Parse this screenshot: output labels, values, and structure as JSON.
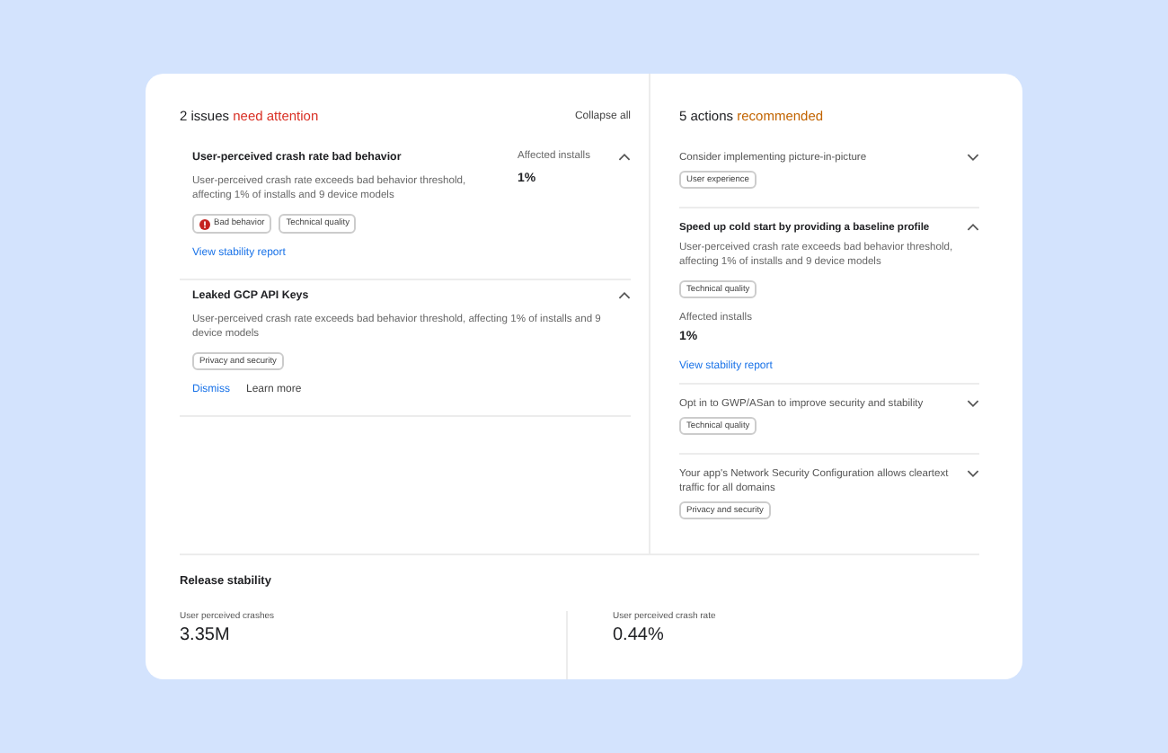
{
  "issues": {
    "count": "2 issues",
    "highlight": "need attention",
    "collapse_all": "Collapse all",
    "items": [
      {
        "title": "User-perceived crash rate bad behavior",
        "expanded": true,
        "description": "User-perceived crash rate exceeds bad behavior threshold, affecting 1% of installs and 9 device models",
        "metric_label": "Affected installs",
        "metric_value": "1%",
        "tags": [
          {
            "label": "Bad behavior",
            "kind": "error"
          },
          {
            "label": "Technical quality"
          }
        ],
        "links": [
          "View stability report"
        ]
      },
      {
        "title": "Leaked GCP API Keys",
        "expanded": true,
        "description": "User-perceived crash rate exceeds bad behavior threshold, affecting 1% of installs and 9 device models",
        "tags": [
          {
            "label": "Privacy and security"
          }
        ],
        "links": [
          "Dismiss",
          "Learn more"
        ]
      }
    ]
  },
  "actions": {
    "count": "5 actions",
    "highlight": "recommended",
    "items": [
      {
        "title": "Consider implementing picture-in-picture",
        "expanded": false,
        "tags": [
          {
            "label": "User experience"
          }
        ]
      },
      {
        "title": "Speed up cold start by providing a baseline profile",
        "expanded": true,
        "description": "User-perceived crash rate exceeds bad behavior threshold, affecting 1% of installs and 9 device models",
        "tags": [
          {
            "label": "Technical quality"
          }
        ],
        "metric_label": "Affected installs",
        "metric_value": "1%",
        "links": [
          "View stability report"
        ]
      },
      {
        "title": "Opt in to GWP/ASan to improve security and stability",
        "expanded": false,
        "tags": [
          {
            "label": "Technical quality"
          }
        ]
      },
      {
        "title": "Your app's Network Security Configuration allows cleartext traffic for all domains",
        "expanded": false,
        "tags": [
          {
            "label": "Privacy and security"
          }
        ]
      }
    ]
  },
  "release_stability": {
    "title": "Release stability",
    "stats": [
      {
        "label": "User perceived crashes",
        "value": "3.35M"
      },
      {
        "label": "User perceived crash rate",
        "value": "0.44%"
      }
    ]
  }
}
